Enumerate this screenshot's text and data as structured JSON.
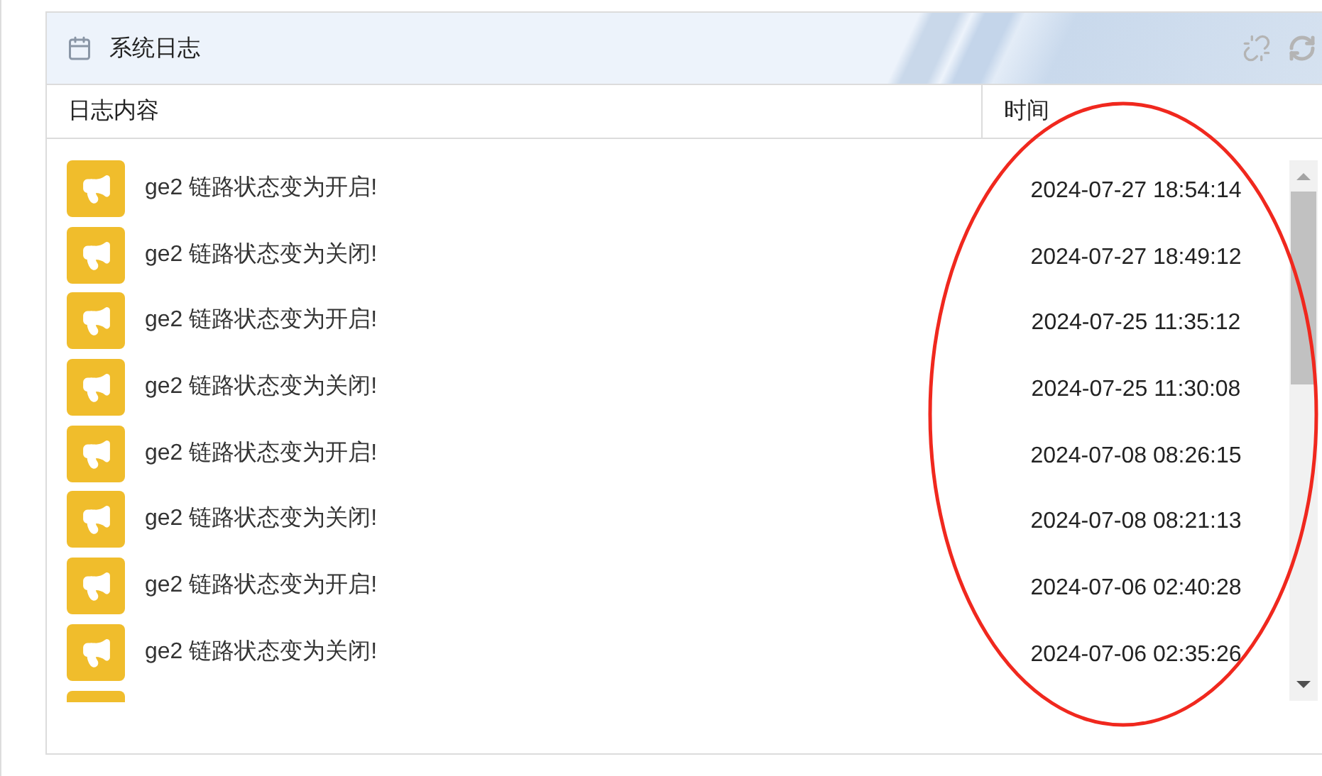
{
  "panel": {
    "title": "系统日志"
  },
  "table": {
    "columns": [
      "日志内容",
      "时间"
    ],
    "rows": [
      {
        "kind": "full",
        "message": "ge2 链路状态变为开启!",
        "time": "2024-07-27 18:54:14"
      },
      {
        "kind": "full",
        "message": "ge2 链路状态变为关闭!",
        "time": "2024-07-27 18:49:12"
      },
      {
        "kind": "full",
        "message": "ge2 链路状态变为开启!",
        "time": "2024-07-25 11:35:12"
      },
      {
        "kind": "full",
        "message": "ge2 链路状态变为关闭!",
        "time": "2024-07-25 11:30:08"
      },
      {
        "kind": "full",
        "message": "ge2 链路状态变为开启!",
        "time": "2024-07-08 08:26:15"
      },
      {
        "kind": "full",
        "message": "ge2 链路状态变为关闭!",
        "time": "2024-07-08 08:21:13"
      },
      {
        "kind": "full",
        "message": "ge2 链路状态变为开启!",
        "time": "2024-07-06 02:40:28"
      },
      {
        "kind": "full",
        "message": "ge2 链路状态变为关闭!",
        "time": "2024-07-06 02:35:26"
      },
      {
        "kind": "partial"
      }
    ]
  },
  "annotation": {
    "kind": "ellipse"
  }
}
